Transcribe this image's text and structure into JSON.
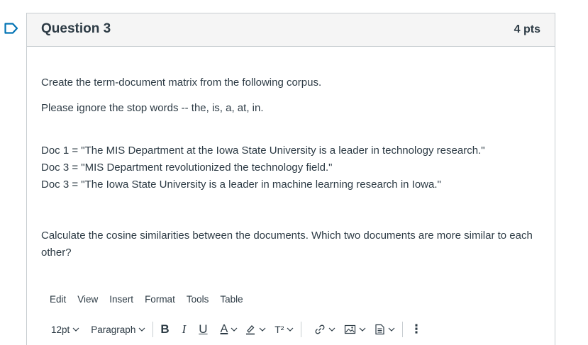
{
  "question": {
    "title": "Question 3",
    "points": "4 pts",
    "prompt": "Create the term-document matrix from the following corpus.",
    "instruction": "Please ignore the stop words -- the, is, a, at, in.",
    "docs": [
      "Doc 1 = \"The MIS Department at the Iowa State University is a leader in technology research.\"",
      "Doc 3 = \"MIS Department revolutionized the technology field.\"",
      "Doc 3 = \"The Iowa State University is a leader in machine learning research in Iowa.\""
    ],
    "followup": "Calculate the cosine similarities between the documents. Which two documents are more similar to each other?"
  },
  "editor": {
    "menu": [
      "Edit",
      "View",
      "Insert",
      "Format",
      "Tools",
      "Table"
    ],
    "font_size": "12pt",
    "block_format": "Paragraph",
    "bold": "B",
    "italic": "I",
    "underline": "U",
    "text_color": "A",
    "superscript": "T²",
    "more": "⋮"
  },
  "colors": {
    "flag": "#0374b5",
    "border": "#c7cdd1",
    "header_bg": "#f5f5f5",
    "text": "#2d3b45"
  },
  "icons": [
    "flag-icon",
    "chevron-down-icon",
    "highlighter-icon",
    "link-icon",
    "image-icon",
    "document-icon",
    "more-vertical-icon"
  ]
}
